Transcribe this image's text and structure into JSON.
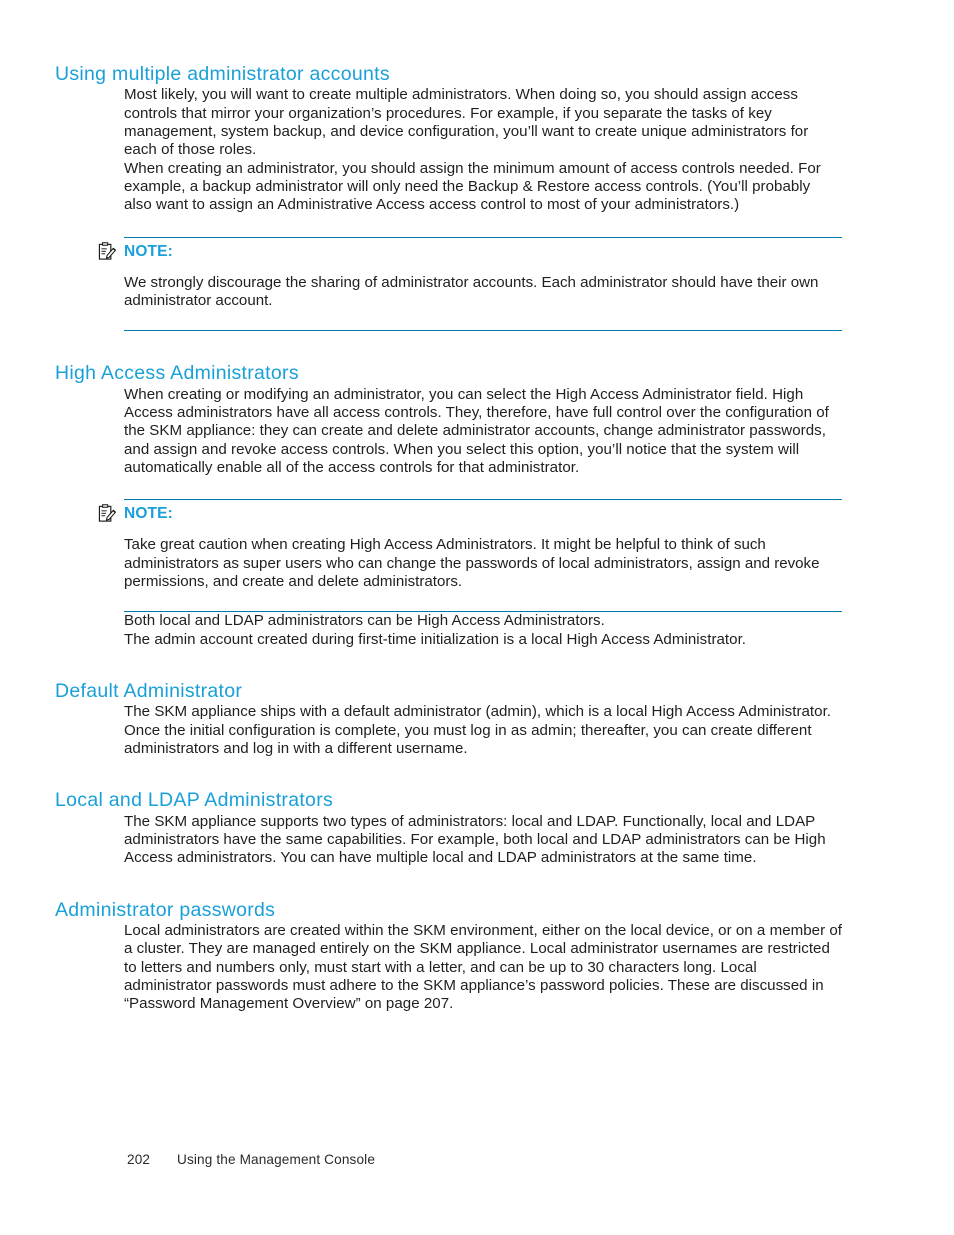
{
  "page": {
    "number": "202",
    "running_footer": "Using the Management Console",
    "heading_color": "#1aa0d8",
    "rule_color": "#0078a8",
    "body_color": "#201f1e"
  },
  "sections": [
    {
      "id": "using-multiple-administrator-accounts",
      "heading": "Using multiple administrator accounts",
      "paragraphs": [
        "Most likely, you will want to create multiple administrators.  When doing so, you should assign access controls that mirror your organization’s procedures.  For example, if you separate the tasks of key management, system backup, and device configuration, you’ll want to create unique administrators for each of those roles.",
        "When creating an administrator, you should assign the minimum amount of access controls needed. For example, a backup administrator will only need the Backup & Restore access controls.  (You’ll probably also want to assign an Administrative Access access control to most of your administrators.)"
      ],
      "note": {
        "icon": "note-clipboard-icon",
        "label": "NOTE:",
        "text": "We strongly discourage the sharing of administrator accounts.  Each administrator should have their own administrator account."
      }
    },
    {
      "id": "high-access-administrators",
      "heading": "High Access Administrators",
      "paragraphs": [
        "When creating or modifying an administrator, you can select the High Access Administrator field.  High Access administrators have all access controls.  They, therefore, have full control over the configuration of the SKM appliance: they can create and delete administrator accounts, change administrator passwords, and assign and revoke access controls.  When you select this option, you’ll notice that the system will automatically enable all of the access controls for that administrator."
      ],
      "note": {
        "icon": "note-clipboard-icon",
        "label": "NOTE:",
        "text": "Take great caution when creating High Access Administrators.  It might be helpful to think of such administrators as super users who can change the passwords of local administrators, assign and revoke permissions, and create and delete administrators."
      },
      "paragraphs_after_note": [
        "Both local and LDAP administrators can be High Access Administrators.",
        "The admin account created during first-time initialization is a local High Access Administrator."
      ]
    },
    {
      "id": "default-administrator",
      "heading": "Default Administrator",
      "paragraphs": [
        "The SKM appliance ships with a default administrator (admin), which is a local High Access Administrator.  Once the initial configuration is complete, you must log in as admin; thereafter, you can create different administrators and log in with a different username."
      ]
    },
    {
      "id": "local-and-ldap-administrators",
      "heading": "Local and LDAP Administrators",
      "paragraphs": [
        "The SKM appliance supports two types of administrators: local and LDAP. Functionally, local and LDAP administrators have the same capabilities.  For example, both local and LDAP administrators can be High Access administrators.  You can have multiple local and LDAP administrators at the same time."
      ]
    },
    {
      "id": "administrator-passwords",
      "heading": "Administrator passwords",
      "paragraphs": [
        "Local administrators are created within the SKM environment, either on the local device, or on a member of a cluster.  They are managed entirely on the SKM appliance.  Local administrator usernames are restricted to letters and numbers only, must start with a letter, and can be up to 30 characters long.  Local administrator passwords must adhere to the SKM appliance’s password policies.  These are discussed in “Password Management Overview” on page 207."
      ]
    }
  ]
}
